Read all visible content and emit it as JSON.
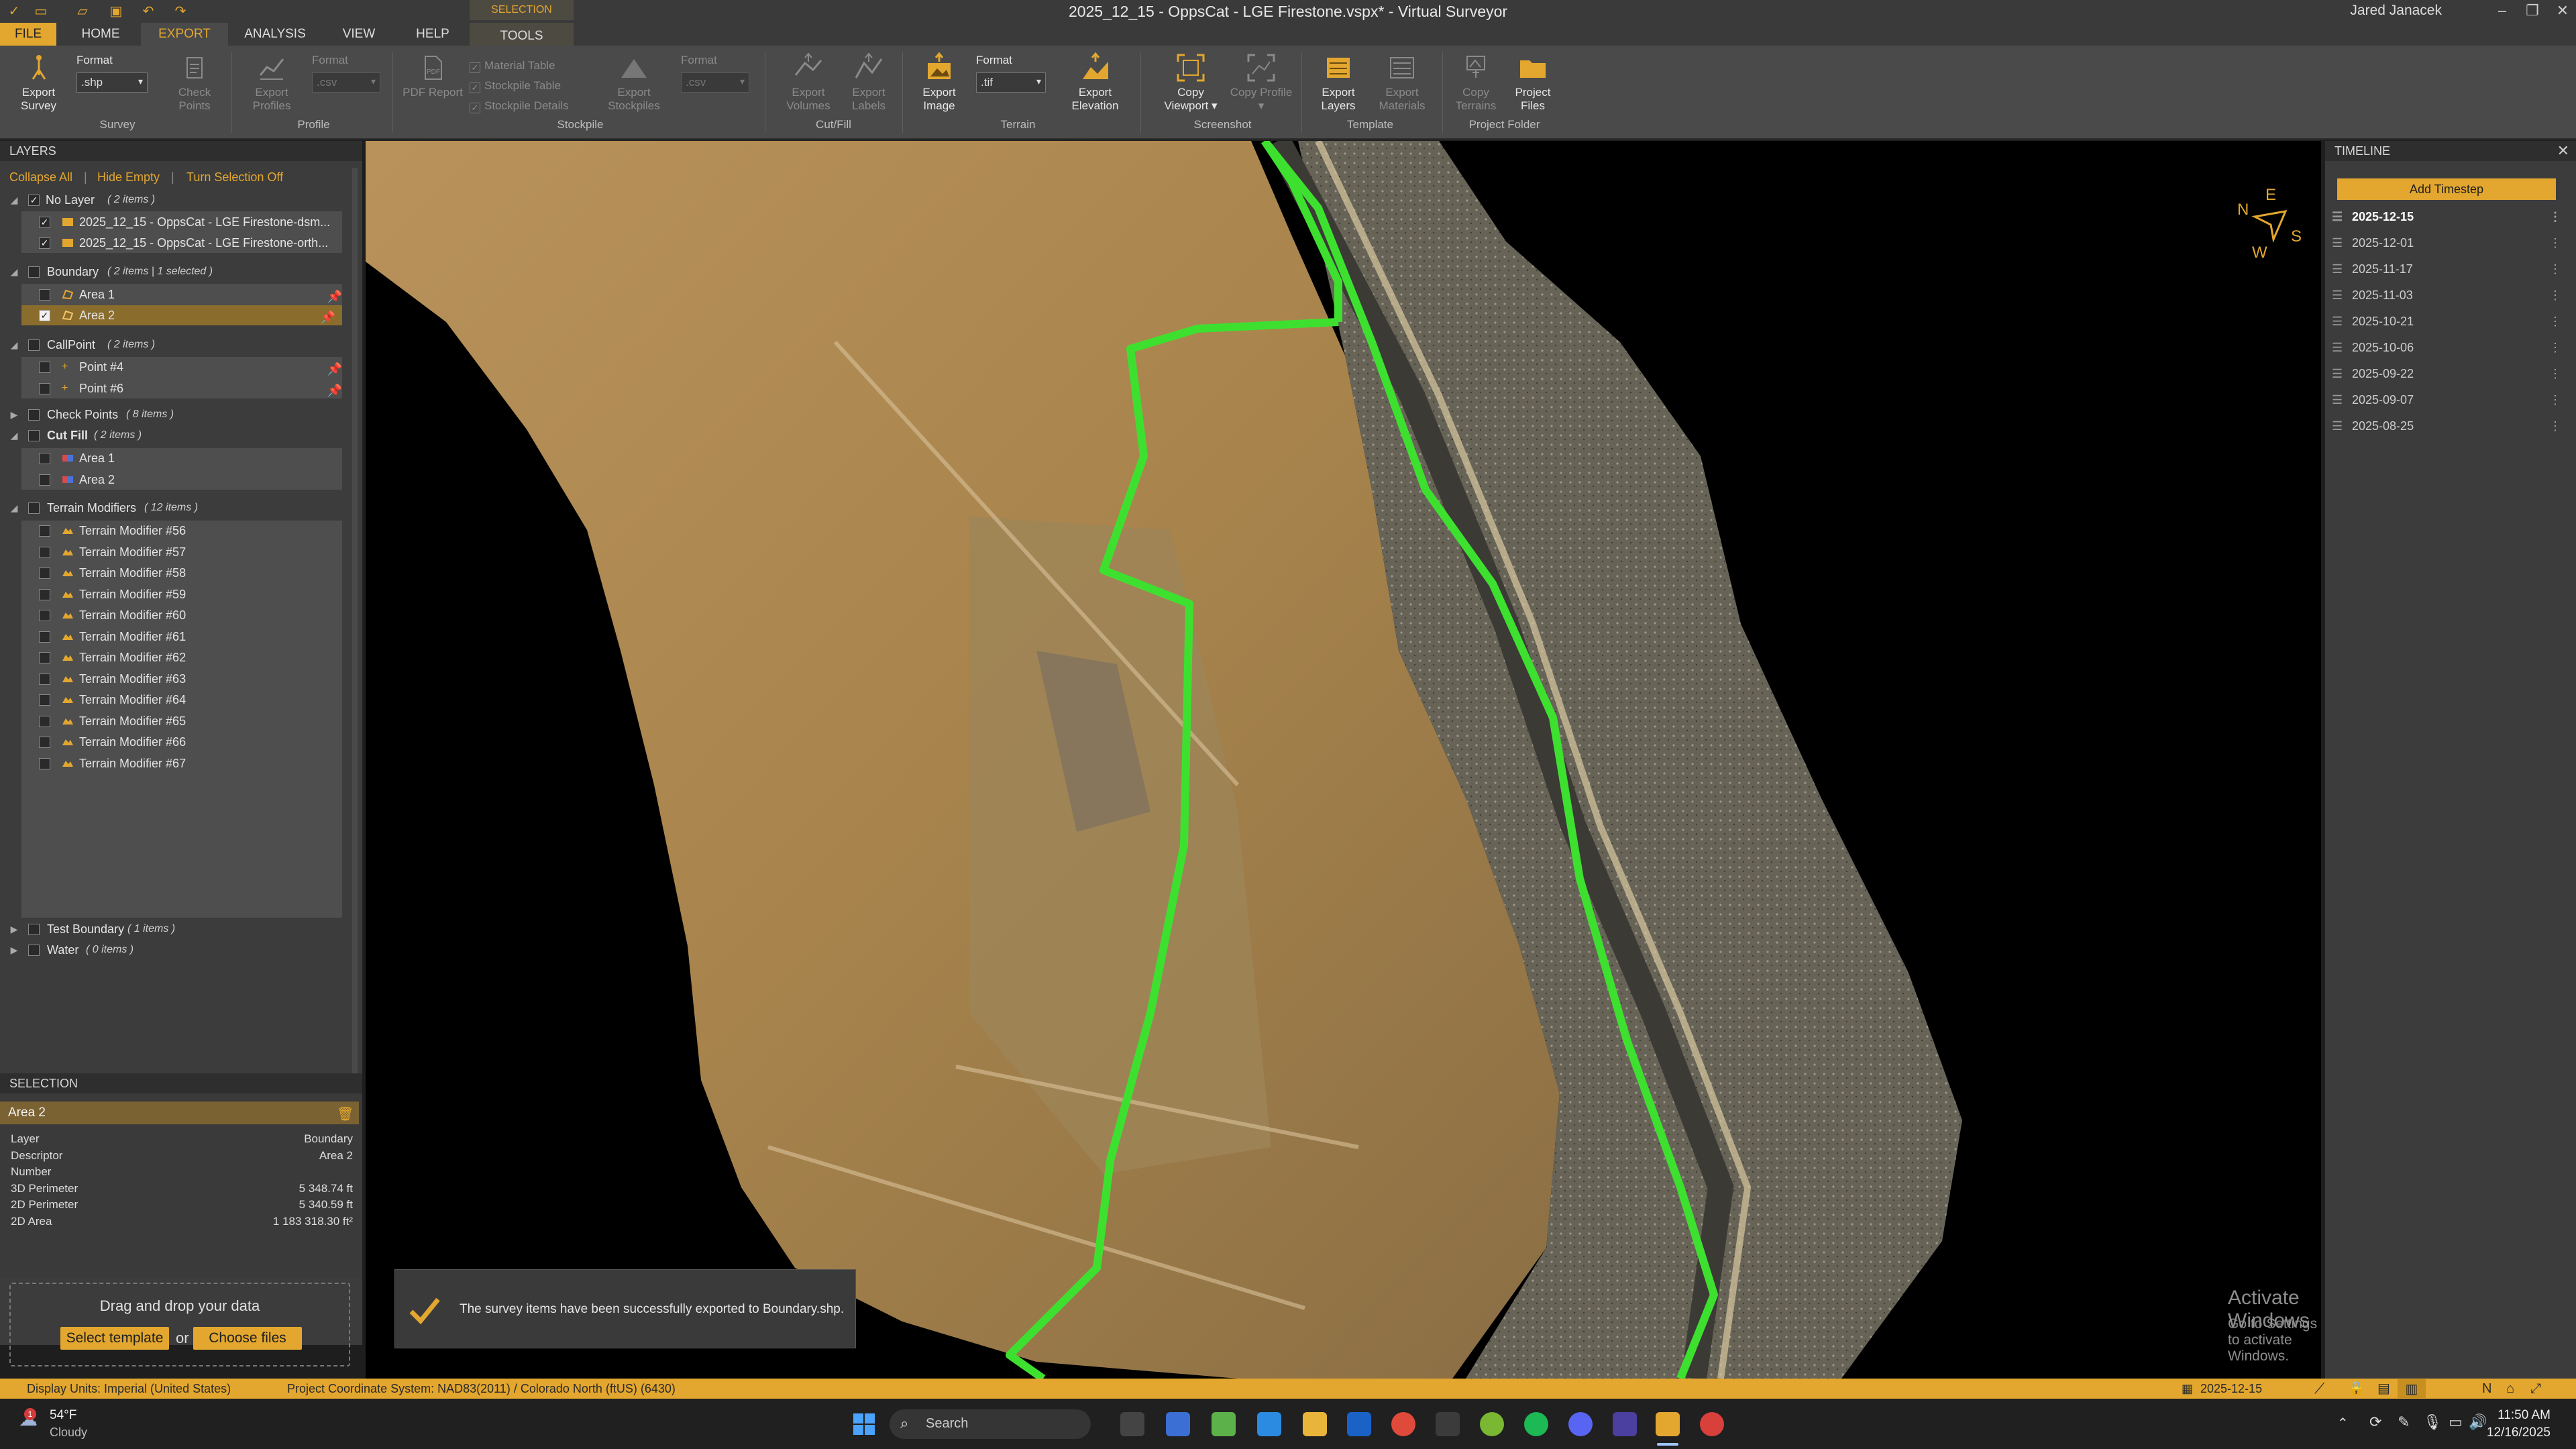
{
  "titlebar": {
    "title": "2025_12_15 - OppsCat - LGE Firestone.vspx*  -  Virtual Surveyor",
    "user": "Jared Janacek"
  },
  "tabs": [
    "FILE",
    "HOME",
    "EXPORT",
    "ANALYSIS",
    "VIEW",
    "HELP",
    "TOOLS"
  ],
  "context_tab_header": "SELECTION",
  "ribbon": {
    "export_survey": "Export Survey",
    "format_label": "Format",
    "survey_format": ".shp",
    "check_points": "Check Points",
    "group_survey": "Survey",
    "export_profiles": "Export Profiles",
    "profile_format": ".csv",
    "group_profile": "Profile",
    "pdf_report": "PDF Report",
    "material_table": "Material Table",
    "stockpile_table": "Stockpile Table",
    "stockpile_details": "Stockpile Details",
    "export_stockpiles": "Export Stockpiles",
    "stockpile_format": ".csv",
    "group_stockpile": "Stockpile",
    "export_volumes": "Export Volumes",
    "export_labels": "Export Labels",
    "group_cutfill": "Cut/Fill",
    "export_image": "Export Image",
    "terrain_format": ".tif",
    "export_elevation": "Export Elevation",
    "group_terrain": "Terrain",
    "copy_viewport": "Copy Viewport ▾",
    "copy_profile": "Copy Profile ▾",
    "group_screenshot": "Screenshot",
    "export_layers": "Export Layers",
    "export_materials": "Export Materials",
    "group_template": "Template",
    "copy_terrains": "Copy Terrains",
    "project_files": "Project Files",
    "group_project_folder": "Project Folder"
  },
  "layers": {
    "header": "LAYERS",
    "collapse_all": "Collapse All",
    "hide_empty": "Hide Empty",
    "turn_selection_off": "Turn Selection Off",
    "no_layer": {
      "name": "No Layer",
      "count": "( 2 items )",
      "items": [
        "2025_12_15 - OppsCat - LGE Firestone-dsm...",
        "2025_12_15 - OppsCat - LGE Firestone-orth..."
      ]
    },
    "boundary": {
      "name": "Boundary",
      "count": "( 2 items | 1 selected )",
      "items": [
        "Area 1",
        "Area 2"
      ]
    },
    "callpoint": {
      "name": "CallPoint",
      "count": "( 2 items )",
      "items": [
        "Point #4",
        "Point #6"
      ]
    },
    "check_points": {
      "name": "Check Points",
      "count": "( 8 items )"
    },
    "cut_fill": {
      "name": "Cut Fill",
      "count": "( 2 items )",
      "items": [
        "Area 1",
        "Area 2"
      ]
    },
    "terrain_modifiers": {
      "name": "Terrain Modifiers",
      "count": "( 12 items )",
      "items": [
        "Terrain Modifier #56",
        "Terrain Modifier #57",
        "Terrain Modifier #58",
        "Terrain Modifier #59",
        "Terrain Modifier #60",
        "Terrain Modifier #61",
        "Terrain Modifier #62",
        "Terrain Modifier #63",
        "Terrain Modifier #64",
        "Terrain Modifier #65",
        "Terrain Modifier #66",
        "Terrain Modifier #67"
      ]
    },
    "test_boundary": {
      "name": "Test Boundary",
      "count": "( 1 items )"
    },
    "water": {
      "name": "Water",
      "count": "( 0 items )"
    }
  },
  "selection": {
    "header": "SELECTION",
    "name": "Area 2",
    "props": [
      {
        "k": "Layer",
        "v": "Boundary"
      },
      {
        "k": "Descriptor",
        "v": "Area 2"
      },
      {
        "k": "Number",
        "v": ""
      },
      {
        "k": "3D Perimeter",
        "v": "5 348.74 ft"
      },
      {
        "k": "2D Perimeter",
        "v": "5 340.59 ft"
      },
      {
        "k": "2D Area",
        "v": "1 183 318.30 ft²"
      }
    ]
  },
  "drop": {
    "title": "Drag and drop your data",
    "select_template": "Select template",
    "or": "or",
    "choose_files": "Choose files"
  },
  "compass": {
    "n": "N",
    "e": "E",
    "s": "S",
    "w": "W"
  },
  "toast": {
    "message": "The survey items have been successfully exported to Boundary.shp."
  },
  "watermark": {
    "title": "Activate Windows",
    "subtitle": "Go to Settings to activate Windows."
  },
  "timeline": {
    "header": "TIMELINE",
    "add_timestep": "Add Timestep",
    "dates": [
      "2025-12-15",
      "2025-12-01",
      "2025-11-17",
      "2025-11-03",
      "2025-10-21",
      "2025-10-06",
      "2025-09-22",
      "2025-09-07",
      "2025-08-25"
    ]
  },
  "statusbar": {
    "display_units": "Display Units:  Imperial (United States)",
    "coord_system": "Project Coordinate System:  NAD83(2011) / Colorado North (ftUS) (6430)",
    "date": "2025-12-15"
  },
  "taskbar": {
    "weather_temp": "54°F",
    "weather_desc": "Cloudy",
    "search": "Search",
    "time": "11:50 AM",
    "date": "12/16/2025",
    "notif_count": "1"
  },
  "colors": {
    "accent": "#e3a72f",
    "boundary_line": "#3ee030"
  }
}
